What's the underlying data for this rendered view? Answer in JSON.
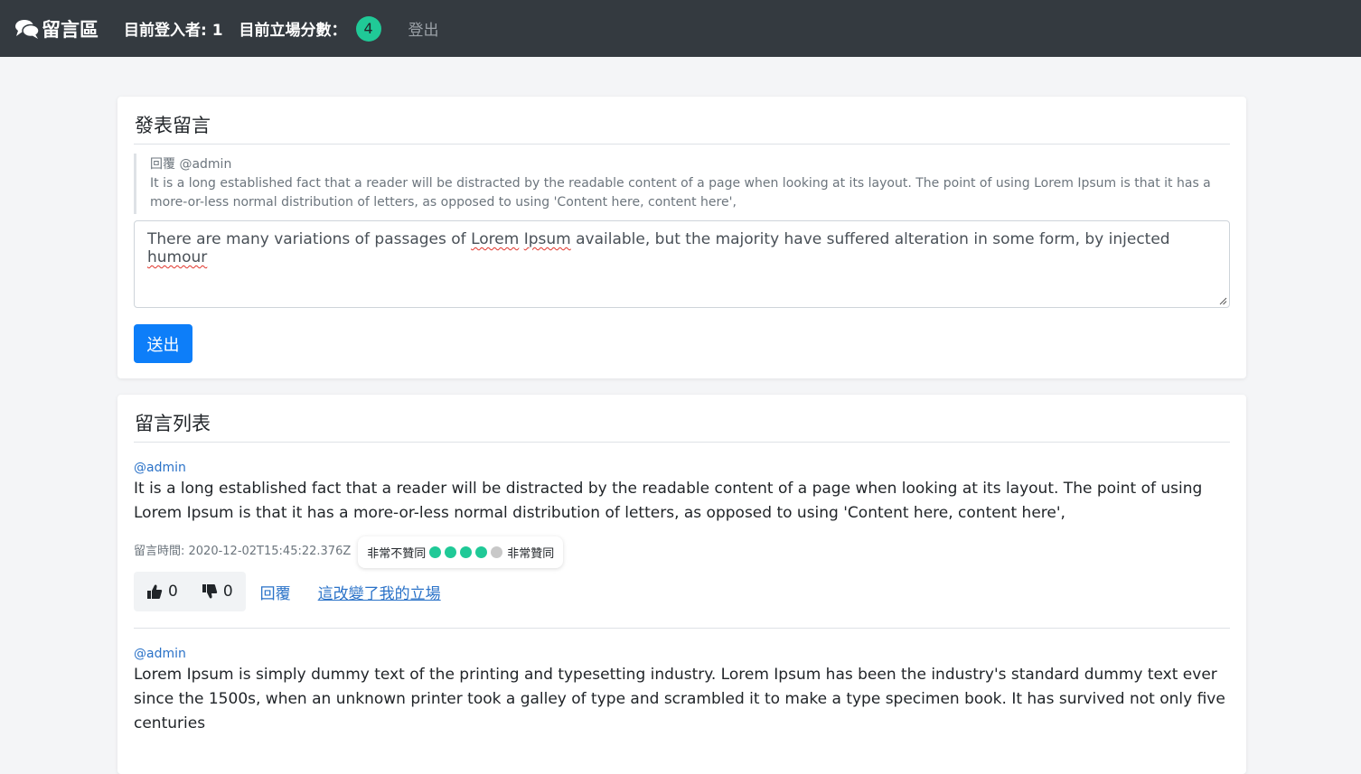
{
  "navbar": {
    "brand": "留言區",
    "logged_in": "目前登入者: 1",
    "score_label": "目前立場分數：",
    "score": "4",
    "logout": "登出"
  },
  "post": {
    "title": "發表留言",
    "reply_to": "回覆 @admin",
    "reply_text": "It is a long established fact that a reader will be distracted by the readable content of a page when looking at its layout. The point of using Lorem Ipsum is that it has a more-or-less normal distribution of letters, as opposed to using 'Content here, content here',",
    "draft_before": "There are many variations of passages of ",
    "draft_word1": "Lorem",
    "draft_word2": "Ipsum",
    "draft_middle": " available, but the majority have suffered alteration in some form, by injected ",
    "draft_word3": "humour",
    "submit": "送出"
  },
  "list": {
    "title": "留言列表",
    "comments": [
      {
        "author": "@admin",
        "body": "It is a long established fact that a reader will be distracted by the readable content of a page when looking at its layout. The point of using Lorem Ipsum is that it has a more-or-less normal distribution of letters, as opposed to using 'Content here, content here',",
        "timestamp": "留言時間: 2020-12-02T15:45:22.376Z",
        "rating_left": "非常不贊同",
        "rating_right": "非常贊同",
        "rating": 4,
        "rating_max": 5,
        "likes": "0",
        "dislikes": "0",
        "reply": "回覆",
        "changed": "這改變了我的立場"
      },
      {
        "author": "@admin",
        "body": "Lorem Ipsum is simply dummy text of the printing and typesetting industry. Lorem Ipsum has been the industry's standard dummy text ever since the 1500s, when an unknown printer took a galley of type and scrambled it to make a type specimen book. It has survived not only five centuries"
      }
    ]
  },
  "colors": {
    "navbar": "#343a40",
    "accent": "#20c997",
    "primary": "#0d7ef9",
    "link": "#2a72c8"
  }
}
